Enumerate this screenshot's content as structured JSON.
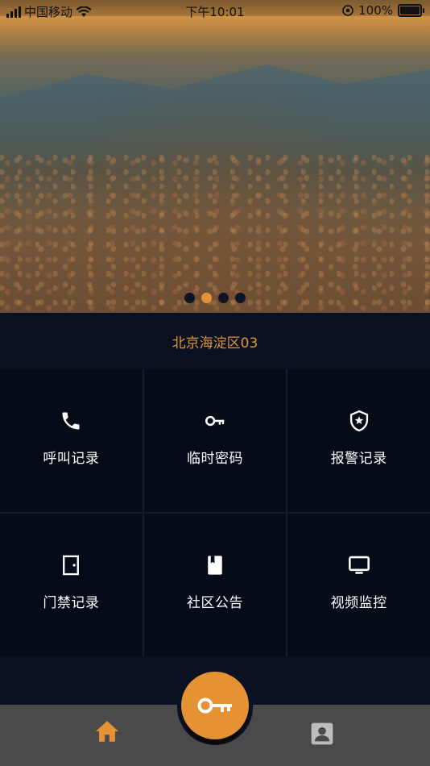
{
  "status_bar": {
    "carrier": "中国移动",
    "time": "下午10:01",
    "battery": "100%"
  },
  "carousel": {
    "total": 4,
    "active_index": 1
  },
  "location_title": "北京海淀区03",
  "grid_items": [
    {
      "label": "呼叫记录",
      "icon": "phone-icon"
    },
    {
      "label": "临时密码",
      "icon": "key-icon"
    },
    {
      "label": "报警记录",
      "icon": "shield-star-icon"
    },
    {
      "label": "门禁记录",
      "icon": "door-icon"
    },
    {
      "label": "社区公告",
      "icon": "bookmark-icon"
    },
    {
      "label": "视频监控",
      "icon": "monitor-icon"
    }
  ],
  "bottom_nav": {
    "home_icon": "home-icon",
    "unlock_icon": "key-icon",
    "profile_icon": "contact-icon"
  },
  "colors": {
    "accent": "#e49233",
    "bg": "#0a1122",
    "cell": "#050b17",
    "nav": "#4a4a4a"
  }
}
